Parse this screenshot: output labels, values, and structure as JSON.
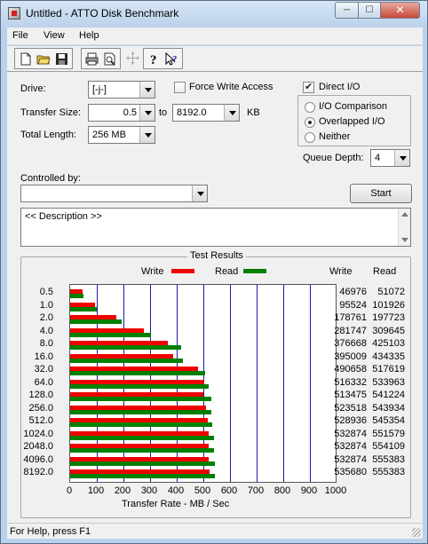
{
  "window": {
    "title": "Untitled - ATTO Disk Benchmark"
  },
  "menu": [
    "File",
    "View",
    "Help"
  ],
  "toolbar": {
    "icons": [
      "new-file-icon",
      "open-folder-icon",
      "save-icon",
      "print-icon",
      "print-preview-icon",
      "move-icon",
      "help-icon",
      "context-help-icon"
    ]
  },
  "settings": {
    "drive_label": "Drive:",
    "drive_value": "[-j-]",
    "force_write_label": "Force Write Access",
    "force_write_checked": false,
    "direct_io_label": "Direct I/O",
    "direct_io_checked": true,
    "transfer_size_label": "Transfer Size:",
    "transfer_from": "0.5",
    "to_label": "to",
    "transfer_to": "8192.0",
    "unit_label": "KB",
    "total_length_label": "Total Length:",
    "total_length": "256 MB",
    "io_options": [
      {
        "label": "I/O Comparison",
        "selected": false
      },
      {
        "label": "Overlapped I/O",
        "selected": true
      },
      {
        "label": "Neither",
        "selected": false
      }
    ],
    "queue_depth_label": "Queue Depth:",
    "queue_depth": "4",
    "controlled_by_label": "Controlled by:",
    "controlled_by_value": "",
    "start_label": "Start",
    "description": "<< Description >>"
  },
  "results": {
    "title": "Test Results",
    "write_header": "Write",
    "read_header": "Read"
  },
  "colors": {
    "write": "#ee0000",
    "read": "#008000",
    "grid": "#1a1aa8"
  },
  "chart_data": {
    "type": "bar",
    "orientation": "horizontal",
    "title": "Test Results",
    "xlabel": "Transfer Rate - MB / Sec",
    "ylabel": "",
    "xlim": [
      0,
      1000
    ],
    "xticks": [
      "0",
      "100",
      "200",
      "300",
      "400",
      "500",
      "600",
      "700",
      "800",
      "900",
      "1000"
    ],
    "categories": [
      "0.5",
      "1.0",
      "2.0",
      "4.0",
      "8.0",
      "16.0",
      "32.0",
      "64.0",
      "128.0",
      "256.0",
      "512.0",
      "1024.0",
      "2048.0",
      "4096.0",
      "8192.0"
    ],
    "series": [
      {
        "name": "Write",
        "values_kb": [
          46976,
          95524,
          178761,
          281747,
          376668,
          395009,
          490658,
          516332,
          513475,
          523518,
          528936,
          532874,
          532874,
          532874,
          535680
        ]
      },
      {
        "name": "Read",
        "values_kb": [
          51072,
          101926,
          197723,
          309645,
          425103,
          434335,
          517619,
          533963,
          541224,
          543934,
          545354,
          551579,
          554109,
          555383,
          555383
        ]
      }
    ],
    "legend": "top",
    "grid": true
  },
  "status": {
    "text": "For Help, press F1"
  }
}
